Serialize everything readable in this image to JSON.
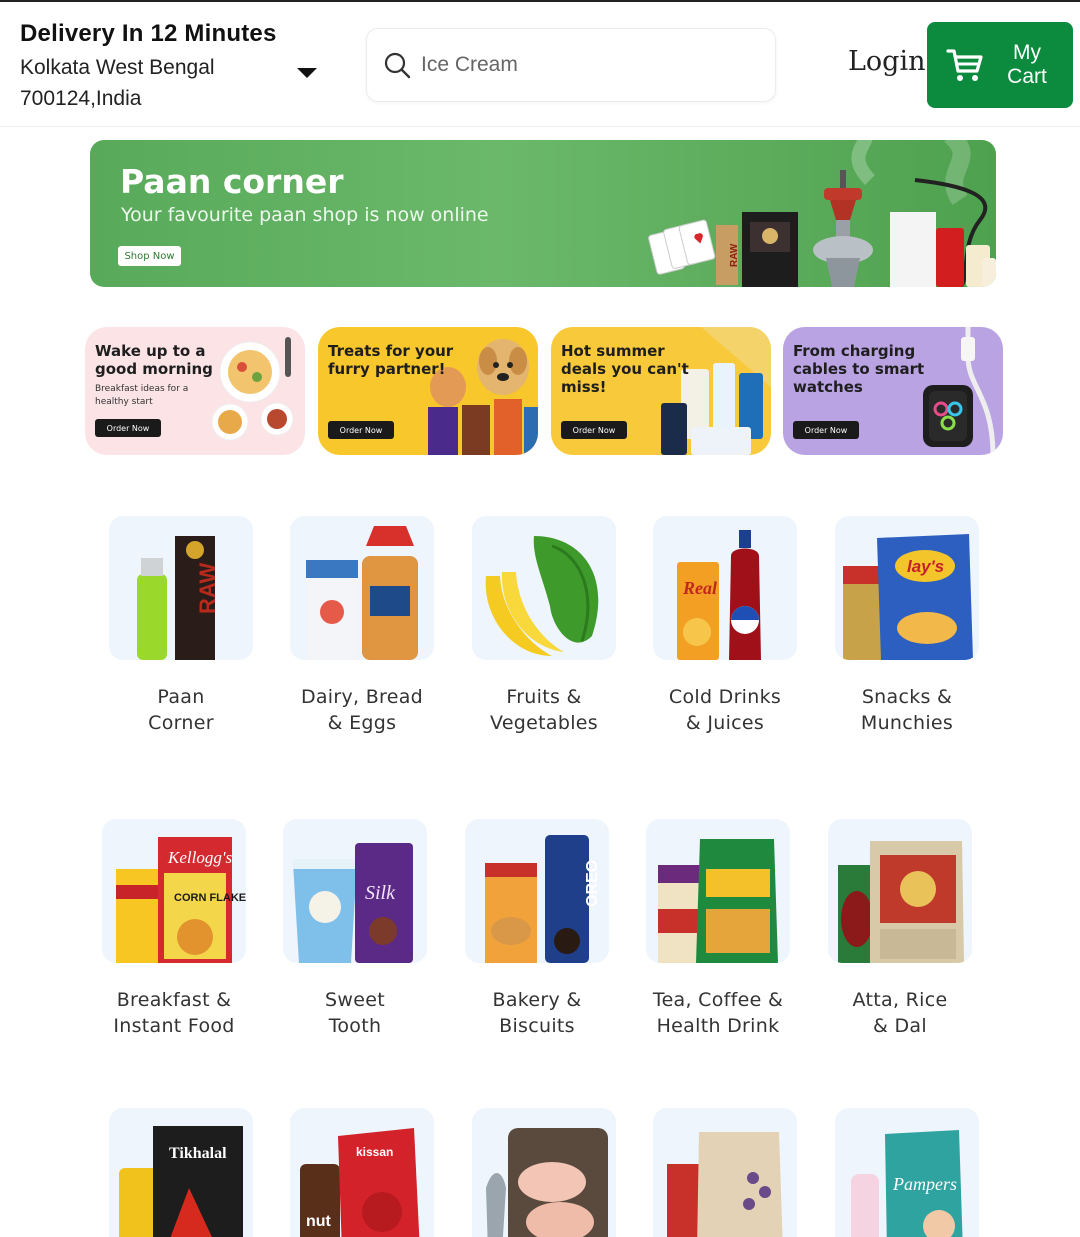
{
  "header": {
    "delivery_title": "Delivery In 12 Minutes",
    "address_line1": "Kolkata West Bengal",
    "address_line2": "700124,India",
    "search_placeholder": "Ice Cream",
    "login_label": "Login",
    "cart_label_line1": "My",
    "cart_label_line2": "Cart"
  },
  "hero": {
    "title": "Paan corner",
    "subtitle": "Your favourite paan shop is now online",
    "button_label": "Shop Now"
  },
  "promos": [
    {
      "title": "Wake up to a good morning",
      "subtitle": "Breakfast ideas for a healthy start",
      "button_label": "Order Now",
      "bg": "#fbe3e6"
    },
    {
      "title": "Treats for your furry partner!",
      "subtitle": "",
      "button_label": "Order Now",
      "bg": "#f7c72b"
    },
    {
      "title": "Hot summer deals you can't miss!",
      "subtitle": "",
      "button_label": "Order Now",
      "bg": "#f8c93a"
    },
    {
      "title": "From charging cables to smart watches",
      "subtitle": "",
      "button_label": "Order Now",
      "bg": "#b9a3e3"
    }
  ],
  "categories": [
    {
      "line1": "Paan",
      "line2": "Corner"
    },
    {
      "line1": "Dairy, Bread",
      "line2": "& Eggs"
    },
    {
      "line1": "Fruits &",
      "line2": "Vegetables"
    },
    {
      "line1": "Cold Drinks",
      "line2": "& Juices"
    },
    {
      "line1": "Snacks &",
      "line2": "Munchies"
    },
    {
      "line1": "Breakfast &",
      "line2": "Instant Food"
    },
    {
      "line1": "Sweet",
      "line2": "Tooth"
    },
    {
      "line1": "Bakery &",
      "line2": "Biscuits"
    },
    {
      "line1": "Tea, Coffee &",
      "line2": "Health Drink"
    },
    {
      "line1": "Atta, Rice",
      "line2": "& Dal"
    }
  ],
  "brand_marks": {
    "raw": "RAW",
    "lays": "lay's",
    "real": "Real",
    "silk": "Silk",
    "oreo": "OREO",
    "corn_flakes": "CORN FLAKES",
    "kelloggs": "Kellogg's",
    "tikhalal": "Tikhalal",
    "pampers": "Pampers",
    "kissan": "kissan"
  },
  "colors": {
    "accent_green": "#0c8a3e",
    "tile_bg": "#eef5fc"
  }
}
